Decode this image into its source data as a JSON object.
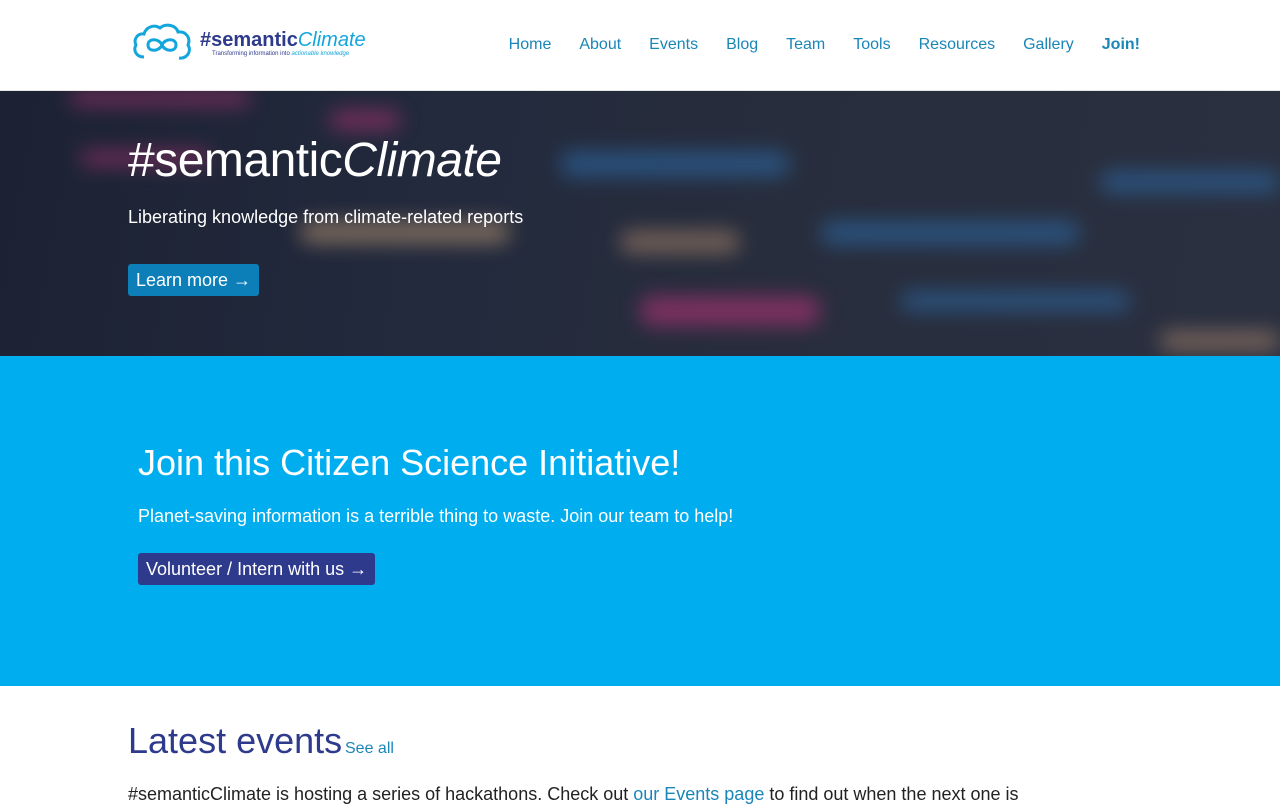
{
  "brand": {
    "logo_name_part1": "#semantic",
    "logo_name_part2": "Climate",
    "tagline_part1": "Transforming information into ",
    "tagline_part2": "actionable knowledge",
    "logo_icon": "cloud-infinity-icon",
    "colors": {
      "navy": "#2e3a8c",
      "cyan": "#00aeef",
      "link": "#1a86b8"
    }
  },
  "nav": {
    "items": [
      {
        "label": "Home"
      },
      {
        "label": "About"
      },
      {
        "label": "Events"
      },
      {
        "label": "Blog"
      },
      {
        "label": "Team"
      },
      {
        "label": "Tools"
      },
      {
        "label": "Resources"
      },
      {
        "label": "Gallery"
      },
      {
        "label": "Join!"
      }
    ]
  },
  "hero": {
    "title_part1": "#semantic",
    "title_part2": "Climate",
    "subtitle": "Liberating knowledge from climate-related reports",
    "button_label": "Learn more →"
  },
  "join": {
    "title": "Join this Citizen Science Initiative!",
    "subtitle": "Planet-saving information is a terrible thing to waste. Join our team to help!",
    "button_label": "Volunteer / Intern with us →"
  },
  "events": {
    "title": "Latest events",
    "see_all_label": "See all",
    "text_before": "#semanticClimate is hosting a series of hackathons. Check out ",
    "link_label": "our Events page",
    "text_after": " to find out when the next one is"
  }
}
